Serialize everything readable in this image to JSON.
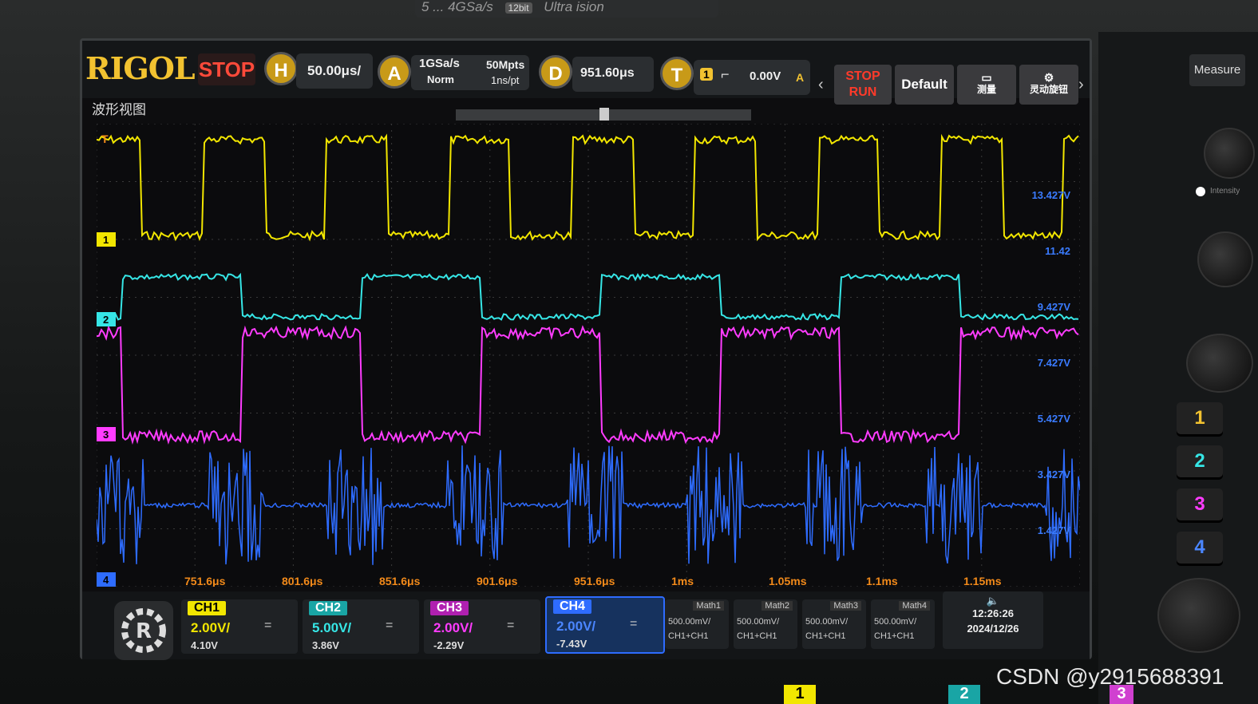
{
  "device": {
    "model_strip": "5 ... 4GSa/s",
    "bit_label": "12bit",
    "series_label": "Ultra ision",
    "brand": "RIGOL",
    "run_state": "STOP"
  },
  "toolbar": {
    "horizontal": {
      "key": "H",
      "timebase": "50.00μs/"
    },
    "acquire": {
      "key": "A",
      "sample_rate": "1GSa/s",
      "mode": "Norm",
      "memory": "50Mpts",
      "resolution": "1ns/pt"
    },
    "delay": {
      "key": "D",
      "value": "951.60μs"
    },
    "trigger": {
      "key": "T",
      "source": "1",
      "level": "0.00V",
      "mode": "A"
    },
    "stop_run_line1": "STOP",
    "stop_run_line2": "RUN",
    "default_label": "Default",
    "measure_label": "测量",
    "smart_knob_label": "灵动旋钮"
  },
  "view": {
    "title": "波形视图",
    "time_labels": [
      "751.6μs",
      "801.6μs",
      "851.6μs",
      "901.6μs",
      "951.6μs",
      "1ms",
      "1.05ms",
      "1.1ms",
      "1.15ms"
    ],
    "voltage_labels": [
      "13.427V",
      "11.42",
      "9.427V",
      "7.427V",
      "5.427V",
      "3.427V",
      "1.427V"
    ],
    "channel_markers": [
      "1",
      "2",
      "3",
      "4"
    ],
    "trigger_marker": "T"
  },
  "channels": [
    {
      "name": "CH1",
      "scale": "2.00V/",
      "offset": "4.10V",
      "coupling": "=",
      "color": "#f2e600"
    },
    {
      "name": "CH2",
      "scale": "5.00V/",
      "offset": "3.86V",
      "coupling": "=",
      "color": "#36e6e6"
    },
    {
      "name": "CH3",
      "scale": "2.00V/",
      "offset": "-2.29V",
      "coupling": "=",
      "color": "#ff3cff"
    },
    {
      "name": "CH4",
      "scale": "2.00V/",
      "offset": "-7.43V",
      "coupling": "=",
      "color": "#2e6cff"
    }
  ],
  "math": [
    {
      "name": "Math1",
      "scale": "500.00mV/",
      "source": "CH1+CH1"
    },
    {
      "name": "Math2",
      "scale": "500.00mV/",
      "source": "CH1+CH1"
    },
    {
      "name": "Math3",
      "scale": "500.00mV/",
      "source": "CH1+CH1"
    },
    {
      "name": "Math4",
      "scale": "500.00mV/",
      "source": "CH1+CH1"
    }
  ],
  "clock": {
    "time": "12:26:26",
    "date": "2024/12/26"
  },
  "panel": {
    "measure_label": "Measure",
    "intensity_label": "Intensity",
    "channel_buttons": [
      "1",
      "2",
      "3",
      "4"
    ]
  },
  "watermark": "CSDN @y2915688391"
}
